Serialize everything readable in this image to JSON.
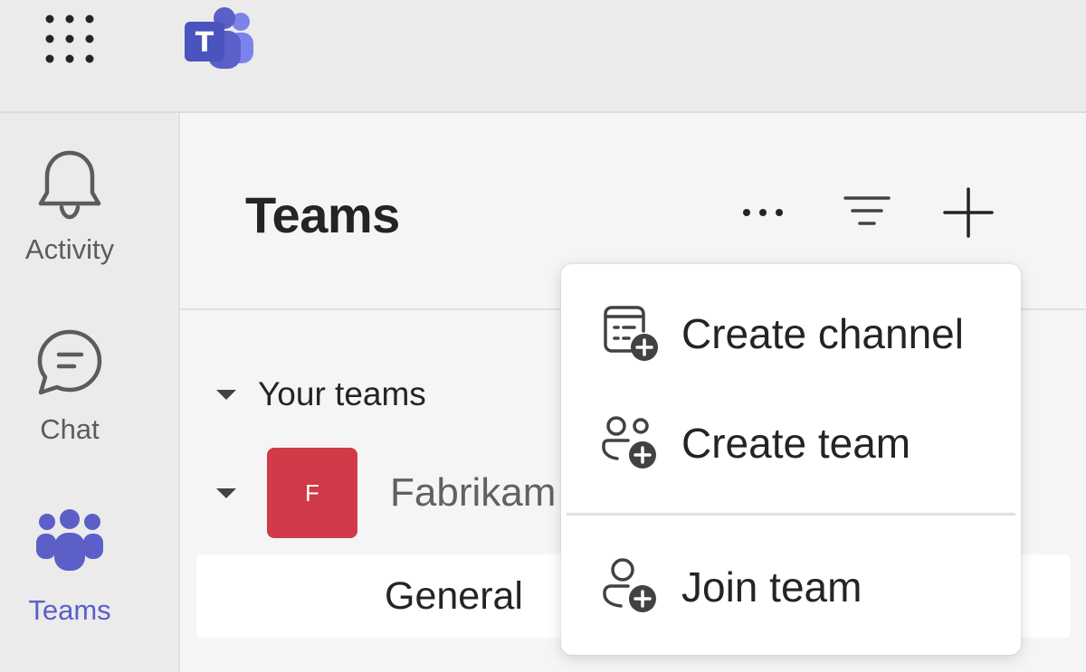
{
  "topbar": {
    "launcher_icon": "app-launcher-grid-icon",
    "logo_icon": "teams-logo-icon",
    "logo_letter": "T"
  },
  "rail": {
    "items": [
      {
        "label": "Activity",
        "icon": "bell-icon",
        "active": false
      },
      {
        "label": "Chat",
        "icon": "chat-icon",
        "active": false
      },
      {
        "label": "Teams",
        "icon": "teams-icon",
        "active": true
      }
    ]
  },
  "panel": {
    "title": "Teams",
    "more_icon": "more-options-icon",
    "filter_icon": "filter-icon",
    "add_icon": "add-icon",
    "section_label": "Your teams",
    "team": {
      "avatar_letter": "F",
      "name": "Fabrikam",
      "avatar_color": "#d13a48"
    },
    "channel": {
      "label": "General"
    }
  },
  "menu": {
    "items": [
      {
        "label": "Create channel",
        "icon": "create-channel-icon"
      },
      {
        "label": "Create team",
        "icon": "create-team-icon"
      },
      {
        "label": "Join team",
        "icon": "join-team-icon"
      }
    ]
  },
  "colors": {
    "accent": "#5b5fc7",
    "background": "#ebebeb",
    "panel": "#f5f5f5"
  }
}
